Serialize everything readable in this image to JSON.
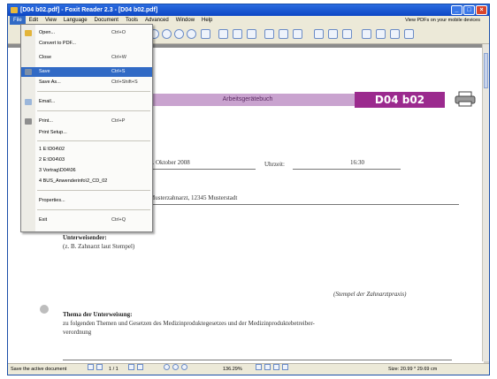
{
  "window": {
    "title": "[D04 b02.pdf] - Foxit Reader 2.3 - [D04 b02.pdf]",
    "minimize": "_",
    "maximize": "□",
    "close": "×"
  },
  "menubar": {
    "items": [
      "File",
      "Edit",
      "View",
      "Language",
      "Document",
      "Tools",
      "Advanced",
      "Window",
      "Help"
    ],
    "device_link": "View PDFs on your mobile devices"
  },
  "file_menu": {
    "items": [
      {
        "label": "Open...",
        "shortcut": "Ctrl+O"
      },
      {
        "label": "Convert to PDF...",
        "shortcut": ""
      },
      {
        "label": "Close",
        "shortcut": "Ctrl+W"
      },
      {
        "label": "Save",
        "shortcut": "Ctrl+S"
      },
      {
        "label": "Save As...",
        "shortcut": "Ctrl+Shift+S"
      },
      {
        "label": "Email...",
        "shortcut": ""
      },
      {
        "label": "Print...",
        "shortcut": "Ctrl+P"
      },
      {
        "label": "Print Setup...",
        "shortcut": ""
      },
      {
        "label": "1 E:\\D04\\02",
        "shortcut": ""
      },
      {
        "label": "2 E:\\D04\\03",
        "shortcut": ""
      },
      {
        "label": "3 Vortrag\\D04\\06",
        "shortcut": ""
      },
      {
        "label": "4 BUS_Anwenderinfo\\2_CD_02",
        "shortcut": ""
      },
      {
        "label": "Properties...",
        "shortcut": ""
      },
      {
        "label": "Exit",
        "shortcut": "Ctrl+Q"
      }
    ]
  },
  "document": {
    "header_band": "Arbeitsgerätebuch",
    "code": "D04 b02",
    "date_text": "0. Oktober 2008",
    "time_label": "Uhrzeit:",
    "time_value": "16:30",
    "address_text": "Musterzahnarzt, 12345 Musterstadt",
    "instructor_heading": "Unterweisender:",
    "instructor_note": "(z. B. Zahnarzt laut Stempel)",
    "stamp_note": "(Stempel der Zahnarztpraxis)",
    "topic_heading": "Thema der Unterweisung:",
    "topic_line1": "zu folgenden Themen und Gesetzen des Medizinproduktegesetzes und der Medizinproduktebetreiber-",
    "topic_line2": "verordnung"
  },
  "statusbar": {
    "message": "Save the active document",
    "page": "1 / 1",
    "zoom": "136.29%",
    "size": "Size: 20.99 * 29.69 cm"
  },
  "colors": {
    "accent": "#9b2a8e",
    "band": "#c9a3cf",
    "selection": "#316ac5"
  }
}
